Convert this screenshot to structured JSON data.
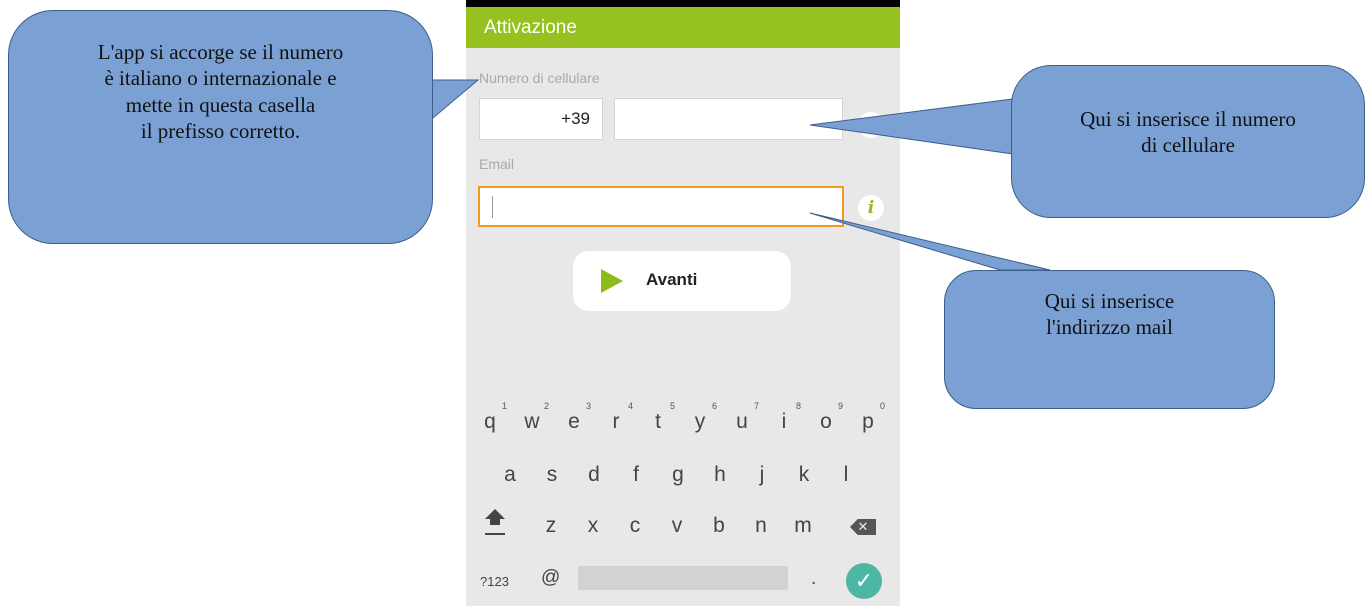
{
  "app": {
    "title": "Attivazione"
  },
  "form": {
    "phone_label": "Numero di cellulare",
    "prefix_value": "+39",
    "phone_value": "",
    "email_label": "Email",
    "email_value": "",
    "info_glyph": "i",
    "next_label": "Avanti"
  },
  "keyboard": {
    "row1": [
      {
        "key": "q",
        "num": "1"
      },
      {
        "key": "w",
        "num": "2"
      },
      {
        "key": "e",
        "num": "3"
      },
      {
        "key": "r",
        "num": "4"
      },
      {
        "key": "t",
        "num": "5"
      },
      {
        "key": "y",
        "num": "6"
      },
      {
        "key": "u",
        "num": "7"
      },
      {
        "key": "i",
        "num": "8"
      },
      {
        "key": "o",
        "num": "9"
      },
      {
        "key": "p",
        "num": "0"
      }
    ],
    "row2": [
      "a",
      "s",
      "d",
      "f",
      "g",
      "h",
      "j",
      "k",
      "l"
    ],
    "row3": [
      "z",
      "x",
      "c",
      "v",
      "b",
      "n",
      "m"
    ],
    "symbols_label": "?123",
    "at_label": "@",
    "dot_label": ".",
    "done_glyph": "✓",
    "backspace_glyph": "✕"
  },
  "callouts": {
    "prefix_note": [
      "L'app si accorge se il numero",
      "è italiano o internazionale e",
      "mette in questa casella",
      "il prefisso corretto."
    ],
    "phone_note": [
      "Qui si inserisce il numero",
      "di cellulare"
    ],
    "email_note": [
      "Qui si inserisce",
      "l'indirizzo mail"
    ]
  },
  "colors": {
    "appbar": "#97c11f",
    "accent_green": "#8dbb1d",
    "email_focus": "#f39a1e",
    "callout_fill": "#7ba0d4",
    "done_button": "#4db6a4"
  }
}
